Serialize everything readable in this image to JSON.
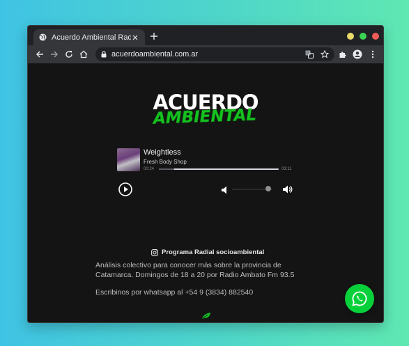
{
  "browser": {
    "tab_title": "Acuerdo Ambiental Radio",
    "url": "acuerdoambiental.com.ar",
    "icons": {
      "favicon": "globe-icon",
      "back": "back-arrow-icon",
      "forward": "forward-arrow-icon",
      "reload": "reload-icon",
      "home": "home-icon",
      "lock": "lock-icon",
      "translate": "translate-icon",
      "bookmark": "star-icon",
      "extensions": "puzzle-icon",
      "profile": "profile-icon",
      "menu": "kebab-menu-icon"
    },
    "window_controls": {
      "minimize": "#e8d96a",
      "maximize": "#39d353",
      "close": "#ef5b57"
    }
  },
  "site": {
    "logo_top": "ACUERDO",
    "logo_bottom": "AMBIENTAL",
    "brand_green": "#15c21f"
  },
  "player": {
    "title": "Weightless",
    "artist": "Fresh Body Shop",
    "current_time": "00:24",
    "duration": "03:11",
    "progress": 0.126,
    "volume": 0.9
  },
  "program": {
    "heading": "Programa Radial socioambiental",
    "description": "Análisis colectivo para conocer más sobre la provincia de Catamarca. Domingos de 18 a 20 por Radio Ambato Fm 93.5",
    "contact": "Escribinos por whatsapp al +54 9 (3834) 882540"
  },
  "colors": {
    "whatsapp_green": "#07d13a",
    "page_bg": "#141414"
  }
}
